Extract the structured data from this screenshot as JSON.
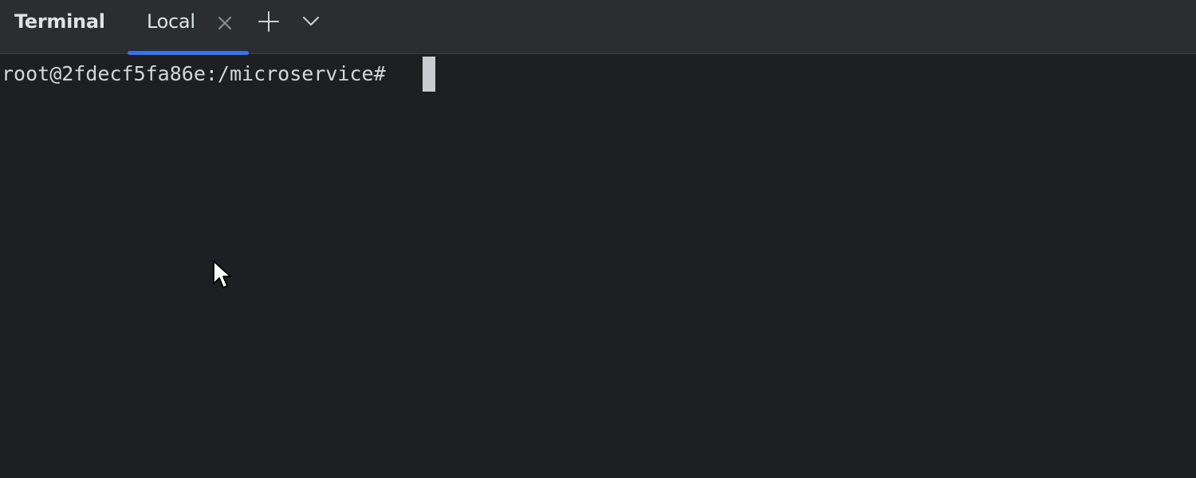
{
  "tool_window": {
    "title": "Terminal"
  },
  "tabs": [
    {
      "label": "Local",
      "active": true
    }
  ],
  "icons": {
    "close": "close-icon",
    "add": "plus-icon",
    "dropdown": "chevron-down-icon",
    "pointer": "mouse-pointer-icon"
  },
  "terminal": {
    "prompt": "root@2fdecf5fa86e:/microservice#"
  },
  "colors": {
    "background": "#1e1f22",
    "header": "#2b2d30",
    "accent": "#3574f0",
    "text": "#dfe1e5"
  }
}
